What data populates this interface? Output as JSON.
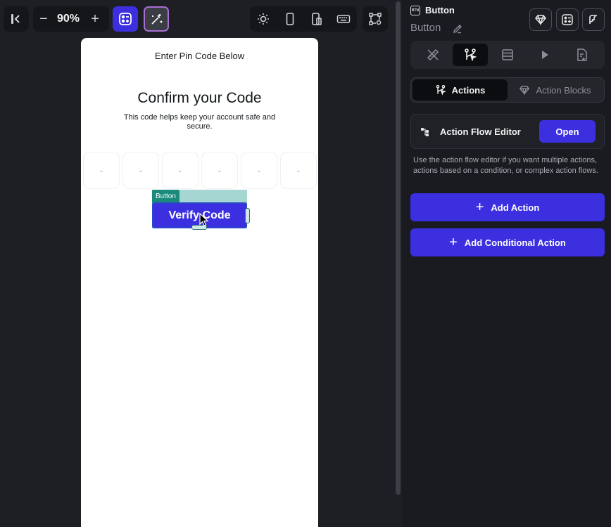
{
  "toolbar": {
    "zoom": "90%",
    "zoom_out_symbol": "−",
    "zoom_in_symbol": "+",
    "icons": [
      "collapse-left-icon",
      "zoom-out-icon",
      "zoom-in-icon",
      "widget-tree-icon",
      "magic-edit-icon",
      "light-mode-icon",
      "phone-device-icon",
      "tablet-device-icon",
      "keyboard-icon",
      "canvas-settings-icon"
    ]
  },
  "phone": {
    "app_bar_title": "Enter Pin Code Below",
    "headline": "Confirm your Code",
    "subtitle": "This code helps keep your account safe and secure.",
    "pin_placeholders": [
      "-",
      "-",
      "-",
      "-",
      "-",
      "-"
    ],
    "selected_widget_tag": "Button",
    "verify_button_label": "Verify Code"
  },
  "panel": {
    "header_badge": "BTN",
    "widget_type": "Button",
    "widget_name": "Button",
    "tabs": [
      "properties-tab",
      "actions-tab",
      "backend-query-tab",
      "animations-tab",
      "documentation-tab"
    ],
    "segments": {
      "actions": "Actions",
      "action_blocks": "Action Blocks"
    },
    "action_flow_editor": {
      "label": "Action Flow Editor",
      "open_label": "Open"
    },
    "help_text": "Use the action flow editor if you want multiple actions, actions based on a condition, or complex action flows.",
    "add_action_label": "Add Action",
    "add_conditional_action_label": "Add Conditional Action",
    "plus_symbol": "+"
  },
  "colors": {
    "accent": "#3b2fe0",
    "selection_teal": "#1a8a7b",
    "background": "#1d1f24",
    "panel": "#191b20"
  }
}
